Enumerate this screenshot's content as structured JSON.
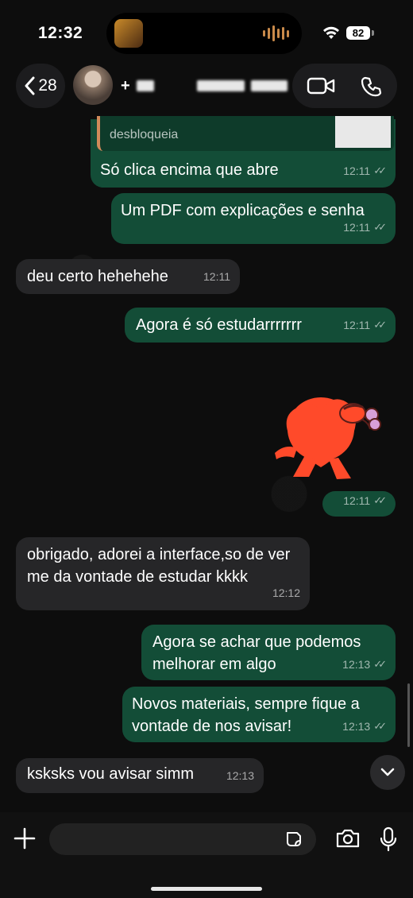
{
  "status_bar": {
    "time": "12:32",
    "battery": "82"
  },
  "header": {
    "back_count": "28",
    "contact_prefix": "+"
  },
  "messages": [
    {
      "dir": "out",
      "reply_text": "desbloqueia",
      "text": "Só clica encima que abre",
      "time": "12:11"
    },
    {
      "dir": "out",
      "text": "Um PDF com explicações e senha",
      "time": "12:11"
    },
    {
      "dir": "in",
      "text": "deu certo hehehehe",
      "time": "12:11"
    },
    {
      "dir": "out",
      "text": "Agora é só estudarrrrrrr",
      "time": "12:11"
    },
    {
      "dir": "out",
      "sticker": "heart-character-sticker",
      "time": "12:11"
    },
    {
      "dir": "in",
      "text": "obrigado, adorei a interface,so de ver me da vontade de estudar kkkk",
      "time": "12:12"
    },
    {
      "dir": "out",
      "text": "Agora se achar que podemos melhorar em algo",
      "time": "12:13"
    },
    {
      "dir": "out",
      "text": "Novos materiais, sempre fique a vontade de nos avisar!",
      "time": "12:13"
    },
    {
      "dir": "in",
      "text": "ksksks vou avisar simm",
      "time": "12:13"
    }
  ],
  "input": {
    "placeholder": ""
  },
  "colors": {
    "outgoing": "#134d37",
    "incoming": "#262628",
    "background": "#0d0d0d"
  }
}
